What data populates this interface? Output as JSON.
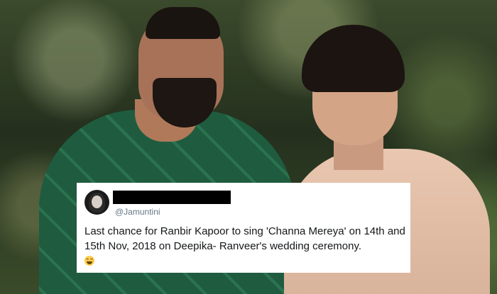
{
  "tweet": {
    "handle": "@Jamuntini",
    "text": "Last chance for Ranbir Kapoor to sing 'Channa Mereya' on 14th and 15th Nov, 2018 on Deepika- Ranveer's wedding ceremony.",
    "emoji": "face-with-tears-of-joy"
  },
  "colors": {
    "card_bg": "#ffffff",
    "handle": "#657786",
    "text": "#14171a",
    "redaction": "#000000"
  }
}
